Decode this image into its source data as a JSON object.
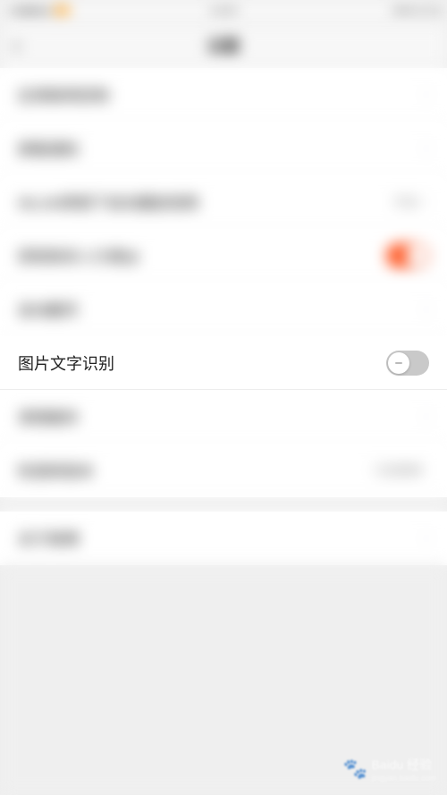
{
  "statusbar": {
    "carrier": "中国移动",
    "time": "14:25",
    "battery_pct": "60%"
  },
  "nav": {
    "back": "‹",
    "title": "设置"
  },
  "rows": {
    "r1": {
      "label": "应用联网控制"
    },
    "r2": {
      "label": "屏蔽通知"
    },
    "r3": {
      "label": "WLAN网络下自动播放视频"
    },
    "r4": {
      "label": "获取联系人方便@"
    },
    "r5": {
      "label": "自动翻页"
    },
    "focus": {
      "label": "图片文字识别"
    },
    "r6": {
      "label": "清理缓存"
    },
    "r7": {
      "label": "检查新版本",
      "value": "已是最新"
    },
    "r8": {
      "label": "关于微博"
    }
  },
  "watermark": {
    "brand": "Baidu 经验",
    "url": "jingyan.baidu.com"
  }
}
